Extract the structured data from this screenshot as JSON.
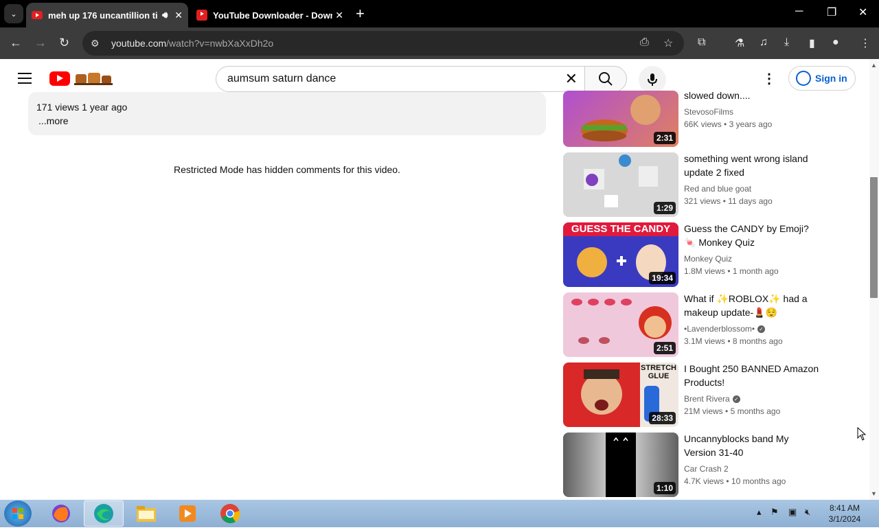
{
  "browser": {
    "tabs": [
      {
        "title": "meh up 176 uncantillion ti",
        "active": true,
        "audio": true
      },
      {
        "title": "YouTube Downloader - Downlo",
        "active": false,
        "audio": false
      }
    ],
    "url_host": "youtube.com",
    "url_path": "/watch?v=nwbXaXxDh2o"
  },
  "youtube": {
    "search_query": "aumsum saturn dance",
    "sign_in_label": "Sign in",
    "description": {
      "meta": "171 views  1 year ago",
      "more": "...more"
    },
    "comments_notice": "Restricted Mode has hidden comments for this video.",
    "related": [
      {
        "title": "slowed down....",
        "channel": "StevosoFilms",
        "verified": false,
        "views": "66K views",
        "age": "3 years ago",
        "duration": "2:31",
        "thumb_color": "#b04fd0"
      },
      {
        "title": "something went wrong island update 2 fixed",
        "channel": "Red and blue goat",
        "verified": false,
        "views": "321 views",
        "age": "11 days ago",
        "duration": "1:29",
        "thumb_color": "#d8d8d8"
      },
      {
        "title": "Guess the CANDY by Emoji? 🍬 Monkey Quiz",
        "channel": "Monkey Quiz",
        "verified": false,
        "views": "1.8M views",
        "age": "1 month ago",
        "duration": "19:34",
        "thumb_color": "#3a3ac0",
        "thumb_text": "GUESS THE CANDY"
      },
      {
        "title": "What if ✨ROBLOX✨ had a makeup update-💄😌",
        "channel": "•Lavenderblossom•",
        "verified": true,
        "views": "3.1M views",
        "age": "8 months ago",
        "duration": "2:51",
        "thumb_color": "#f0c8dc"
      },
      {
        "title": "I Bought 250 BANNED Amazon Products!",
        "channel": "Brent Rivera",
        "verified": true,
        "views": "21M views",
        "age": "5 months ago",
        "duration": "28:33",
        "thumb_color": "#f0e8e0",
        "thumb_text": "STRETCH GLUE"
      },
      {
        "title": "Uncannyblocks band My Version 31-40",
        "channel": "Car Crash 2",
        "verified": false,
        "views": "4.7K views",
        "age": "10 months ago",
        "duration": "1:10",
        "thumb_color": "#3a3a3a"
      }
    ]
  },
  "taskbar": {
    "time": "8:41 AM",
    "date": "3/1/2024"
  }
}
